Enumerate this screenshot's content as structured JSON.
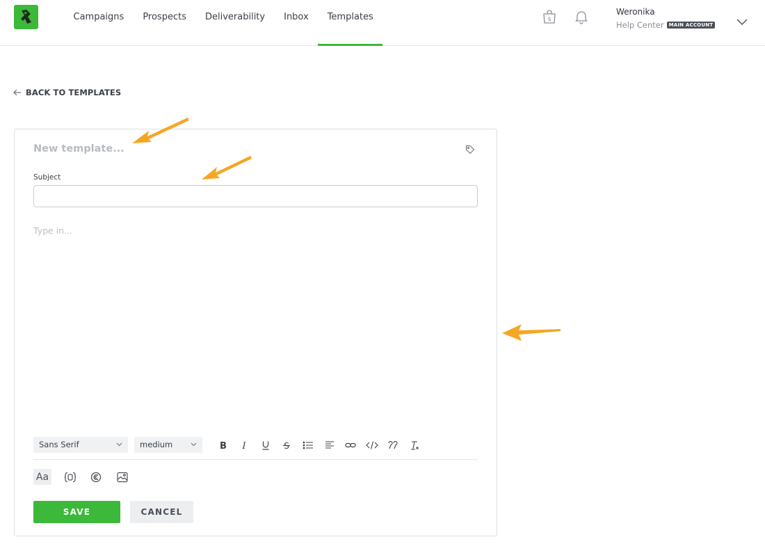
{
  "nav": {
    "items": [
      {
        "label": "Campaigns",
        "active": false
      },
      {
        "label": "Prospects",
        "active": false
      },
      {
        "label": "Deliverability",
        "active": false
      },
      {
        "label": "Inbox",
        "active": false
      },
      {
        "label": "Templates",
        "active": true
      }
    ]
  },
  "header": {
    "user_name": "Weronika",
    "account_label": "Help Center",
    "account_badge": "MAIN ACCOUNT",
    "icons": [
      "shopping-bag-dollar-icon",
      "bell-icon",
      "chevron-down-icon"
    ]
  },
  "back": {
    "label": "BACK TO TEMPLATES"
  },
  "editor": {
    "name_placeholder": "New template...",
    "subject_label": "Subject",
    "subject_value": "",
    "body_placeholder": "Type in...",
    "font_family": "Sans Serif",
    "font_size": "medium",
    "format_tools": [
      "bold-icon",
      "italic-icon",
      "underline-icon",
      "strikethrough-icon",
      "bullet-list-icon",
      "align-icon",
      "link-icon",
      "code-icon",
      "quote-icon",
      "clear-format-icon"
    ],
    "extra_tools": [
      "text-format-icon",
      "variables-icon",
      "spintax-icon",
      "image-icon"
    ],
    "aa_label": "Aa",
    "save_label": "SAVE",
    "cancel_label": "CANCEL"
  },
  "colors": {
    "brand": "#3cb83a",
    "annotation_arrow": "#f5a623"
  }
}
